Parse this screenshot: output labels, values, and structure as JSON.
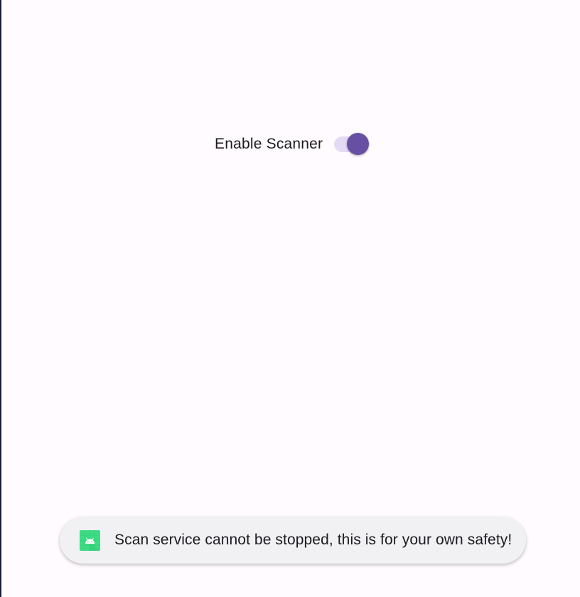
{
  "settings": {
    "scanner_toggle": {
      "label": "Enable Scanner",
      "checked": true
    }
  },
  "toast": {
    "icon": "android-app-icon",
    "message": "Scan service cannot be stopped, this is for your own safety!"
  },
  "colors": {
    "background": "#FFFBFE",
    "switch_thumb": "#6750A4",
    "switch_track": "#E5DAF6",
    "toast_background": "#F1F0F3",
    "app_icon": "#3DDC84"
  }
}
